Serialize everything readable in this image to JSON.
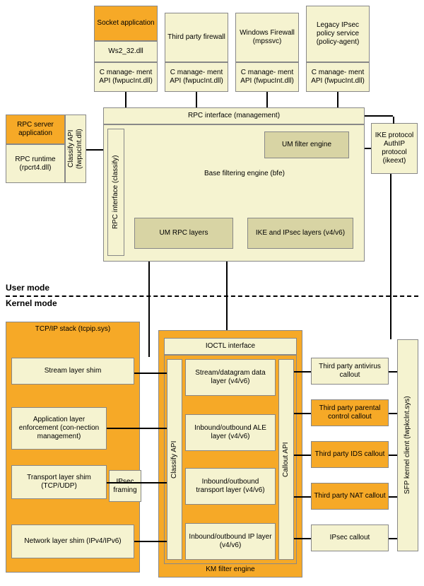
{
  "top": {
    "socket_app": "Socket application",
    "ws2": "Ws2_32.dll",
    "cmgmt": "C manage-\nment API (fwpucInt.dll)",
    "third_party_fw": "Third party firewall",
    "windows_fw": "Windows Firewall (mpssvc)",
    "legacy_ipsec": "Legacy IPsec policy service (policy-agent)"
  },
  "rpc": {
    "server_app": "RPC server application",
    "runtime": "RPC runtime (rpcrt4.dll)",
    "classify_api": "Classify API (fwpucInt.dll)"
  },
  "mgmt": {
    "rpc_interface": "RPC interface (management)",
    "rpc_classify": "RPC interface (classify)",
    "um_filter": "UM filter engine",
    "bfe": "Base filtering engine (bfe)",
    "um_rpc": "UM RPC layers",
    "ike_ipsec": "IKE and IPsec layers (v4/v6)",
    "ike_proto": "IKE protocol AuthIP protocol (ikeext)"
  },
  "modes": {
    "user": "User mode",
    "kernel": "Kernel mode"
  },
  "tcpip": {
    "title": "TCP/IP stack (tcpip.sys)",
    "stream_shim": "Stream layer shim",
    "ale": "Application layer enforcement (con-nection management)",
    "transport_shim": "Transport layer shim (TCP/UDP)",
    "network_shim": "Network layer shim (IPv4/IPv6)",
    "ipsec_framing": "IPsec framing"
  },
  "km": {
    "ioctl": "IOCTL interface",
    "classify_api": "Classify API",
    "callout_api": "Callout API",
    "stream_data": "Stream/datagram data layer (v4/v6)",
    "ale_layer": "Inbound/outbound ALE layer (v4/v6)",
    "transport_layer": "Inbound/outbound transport layer (v4/v6)",
    "ip_layer": "Inbound/outbound IP layer (v4/v6)",
    "title": "KM filter engine"
  },
  "callouts": {
    "antivirus": "Third party antivirus callout",
    "parental": "Third party parental control callout",
    "ids": "Third party IDS callout",
    "nat": "Third party NAT callout",
    "ipsec": "IPsec callout"
  },
  "sfp": "SFP kernel client (fwpkclnt.sys)"
}
